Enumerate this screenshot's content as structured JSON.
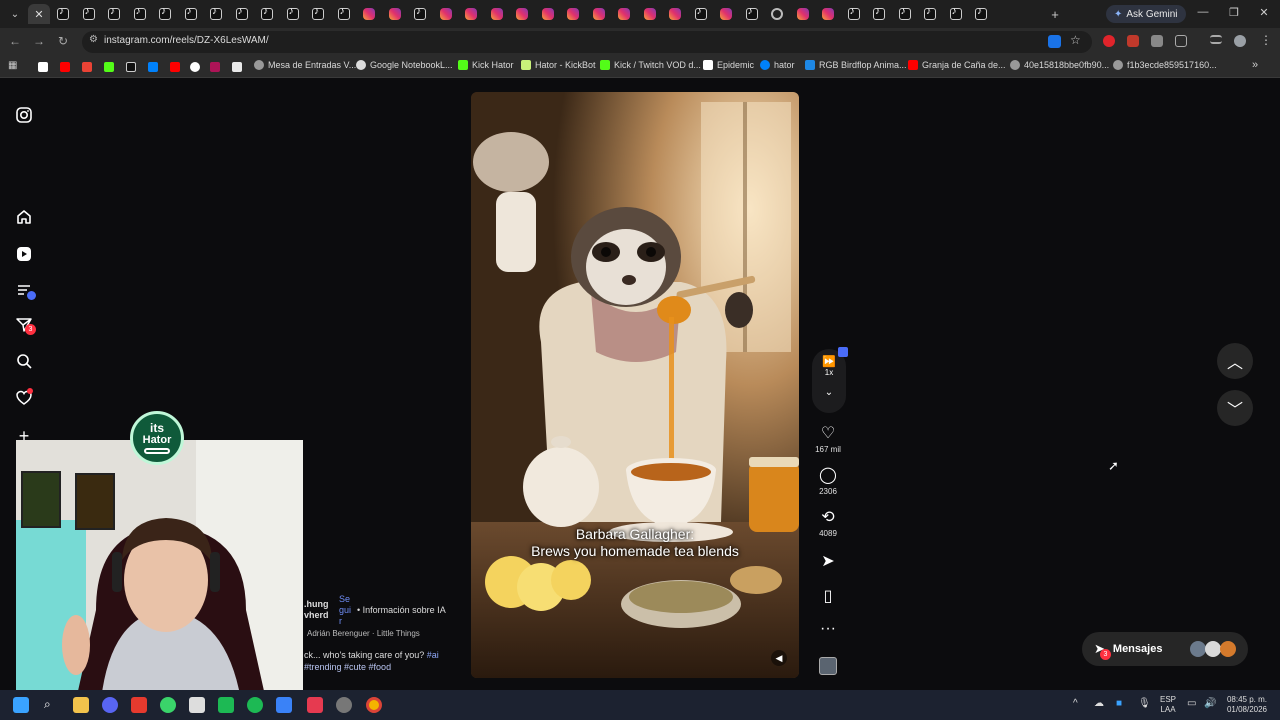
{
  "browser": {
    "url": "instagram.com/reels/DZ-X6LesWAM/",
    "ask_gemini_label": "Ask Gemini",
    "tab_favicons": [
      "tiktok",
      "tiktok",
      "tiktok",
      "tiktok",
      "tiktok",
      "tiktok",
      "tiktok",
      "tiktok",
      "tiktok",
      "tiktok",
      "tiktok",
      "tiktok",
      "instagram",
      "instagram",
      "tiktok",
      "instagram",
      "instagram",
      "instagram",
      "instagram",
      "instagram",
      "instagram",
      "instagram",
      "instagram",
      "instagram",
      "instagram",
      "tiktok",
      "instagram",
      "tiktok",
      "globe",
      "instagram",
      "instagram",
      "tiktok",
      "tiktok",
      "tiktok",
      "tiktok",
      "tiktok",
      "tiktok"
    ]
  },
  "bookmarks": [
    {
      "label": "Mesa de Entradas V...",
      "icon": "globe-icon"
    },
    {
      "label": "Google NotebookL...",
      "icon": "notebook-icon"
    },
    {
      "label": "Kick Hator",
      "icon": "kick-icon"
    },
    {
      "label": "Hator - KickBot",
      "icon": "bot-icon"
    },
    {
      "label": "Kick / Twitch VOD d...",
      "icon": "download-icon"
    },
    {
      "label": "Epidemic",
      "icon": "epidemic-icon"
    },
    {
      "label": "hator",
      "icon": "meta-icon"
    },
    {
      "label": "RGB Birdflop Anima...",
      "icon": "birdflop-icon"
    },
    {
      "label": "Granja de Caña de...",
      "icon": "youtube-icon"
    },
    {
      "label": "40e15818bbe0fb90...",
      "icon": "globe-icon"
    },
    {
      "label": "f1b3ecde859517160...",
      "icon": "globe-icon"
    }
  ],
  "sidebar": {
    "messages_badge": "3"
  },
  "reel": {
    "caption_line1": "Barbara Gallagher:",
    "caption_line2": "Brews you homemade tea blends",
    "speed_label": "1x",
    "likes": "167 mil",
    "comments": "2306",
    "reposts": "4089"
  },
  "post_info": {
    "user_line1": ".hung",
    "user_line2": "vherd",
    "follow_lines": [
      "Se",
      "gui",
      "r"
    ],
    "ai_label": "• Información sobre IA",
    "audio": "Adrián Berenguer · Little Things",
    "desc_line1": "ck... who's taking care of you?",
    "desc_tag": "#ai",
    "desc_line2": "#trending #cute #food"
  },
  "messages": {
    "label": "Mensajes",
    "badge": "3"
  },
  "overlay": {
    "logo_line1": "its",
    "logo_line2": "Hator"
  },
  "taskbar": {
    "lang1": "ESP",
    "lang2": "LAA",
    "time": "08:45 p. m.",
    "date": "01/08/2026"
  }
}
